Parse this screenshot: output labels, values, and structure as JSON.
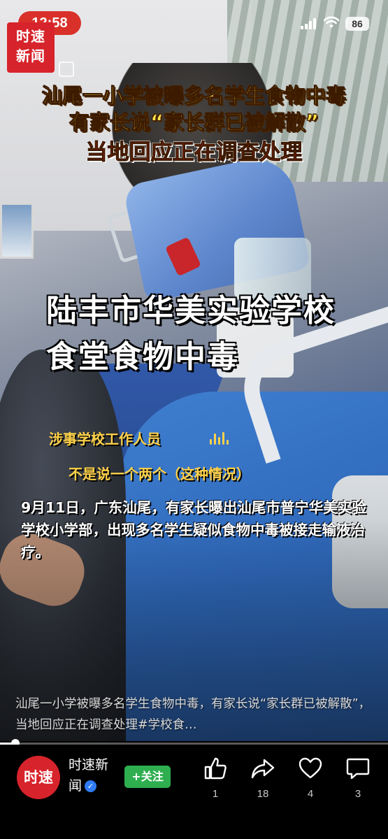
{
  "status_bar": {
    "time": "12:58",
    "battery": "86"
  },
  "logo": {
    "line1": "时速",
    "line2": "新闻"
  },
  "headline": {
    "line1": "汕尾一小学被曝多名学生食物中毒",
    "line2": "有家长说“家长群已被解散”",
    "line3": "当地回应正在调查处理"
  },
  "overlay": {
    "line1": "陆丰市华美实验学校",
    "line2": "食堂食物中毒"
  },
  "quote": {
    "line1": "涉事学校工作人员",
    "line2": "不是说一个两个（这种情况）"
  },
  "caption": "9月11日，广东汕尾，有家长曝出汕尾市普宁华美实验学校小学部，出现多名学生疑似食物中毒被接走输液治疗。",
  "description": "汕尾一小学被曝多名学生食物中毒，有家长说“家长群已被解散”，当地回应正在调查处理#学校食…",
  "progress": 0.04,
  "channel": {
    "avatar_text": "时速",
    "name": "时速新闻",
    "follow_label": "+关注"
  },
  "actions": [
    {
      "icon": "thumbs-up-icon",
      "count": "1"
    },
    {
      "icon": "share-icon",
      "count": "18"
    },
    {
      "icon": "heart-icon",
      "count": "4"
    },
    {
      "icon": "comment-icon",
      "count": "3"
    }
  ],
  "colors": {
    "accent_red": "#d7232b",
    "headline_yellow": "#ffe44d",
    "follow_green": "#2fae4f",
    "verified_blue": "#2f7cf6"
  }
}
